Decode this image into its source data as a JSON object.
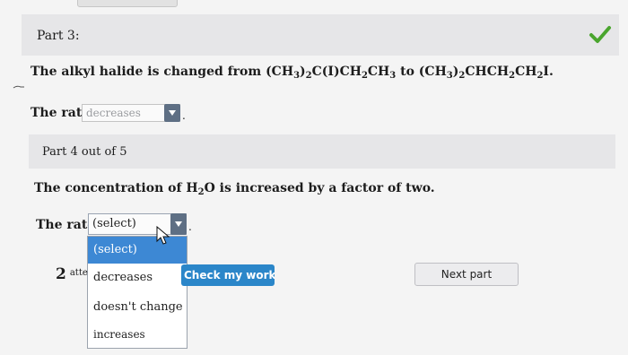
{
  "part3": {
    "label": "Part 3:",
    "statement": {
      "prefix": "The alkyl halide is changed from (CH",
      "s1": "3",
      "t1": ")",
      "s2": "2",
      "t2": "C(I)CH",
      "s3": "2",
      "t3": "CH",
      "s4": "3",
      "t4": " to (CH",
      "s5": "3",
      "t5": ")",
      "s6": "2",
      "t6": "CHCH",
      "s7": "2",
      "t7": "CH",
      "s8": "2",
      "t8": "I."
    },
    "rate_label": "The rate",
    "rate_value": "decreases",
    "period": ".",
    "checkmark_icon": "checkmark-icon",
    "checkmark_color": "#4aa52e"
  },
  "part4": {
    "label": "Part 4 out of 5",
    "statement": {
      "prefix": "The concentration of H",
      "sub": "2",
      "suffix": "O is increased by a factor of two."
    },
    "rate_label": "The rate",
    "rate_value": "(select)",
    "period": ".",
    "options": [
      "(select)",
      "decreases",
      "doesn't change",
      "increases"
    ]
  },
  "footer": {
    "attempts_count": "2",
    "attempts_label": "atte",
    "check_button": "Check my work",
    "next_button": "Next part"
  },
  "colors": {
    "accent": "#2b86c9",
    "selected_option": "#3d88d4",
    "select_arrow": "#5e6f84",
    "success": "#4aa52e"
  }
}
